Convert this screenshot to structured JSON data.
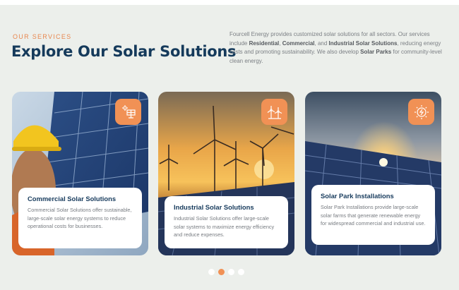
{
  "header": {
    "eyebrow": "OUR SERVICES",
    "title": "Explore Our Solar Solutions",
    "intro": {
      "p1": "Fourcell Energy provides customized solar solutions for all sectors. Our services include ",
      "b1": "Residential",
      "p2": ", ",
      "b2": "Commercial",
      "p3": ", and ",
      "b3": "Industrial Solar Solutions",
      "p4": ", reducing energy costs and promoting sustainability. We also develop ",
      "b4": "Solar Parks",
      "p5": " for community-level clean energy."
    }
  },
  "cards": [
    {
      "title": "Commercial Solar Solutions",
      "desc": "Commercial Solar Solutions offer sustainable, large-scale solar energy systems to reduce operational costs for businesses.",
      "icon": "solar-panel-icon"
    },
    {
      "title": "Industrial Solar Solutions",
      "desc": "Industrial Solar Solutions offer large-scale solar systems to maximize energy efficiency and reduce expenses.",
      "icon": "wind-turbine-icon"
    },
    {
      "title": "Solar Park Installations",
      "desc": "Solar Park Installations provide large-scale solar farms that generate renewable energy for widespread commercial and industrial use.",
      "icon": "sun-energy-icon"
    }
  ],
  "carousel": {
    "pages": 4,
    "active": 2
  },
  "colors": {
    "accent": "#f19155",
    "heading": "#153a5b",
    "background": "#ecefeb"
  }
}
